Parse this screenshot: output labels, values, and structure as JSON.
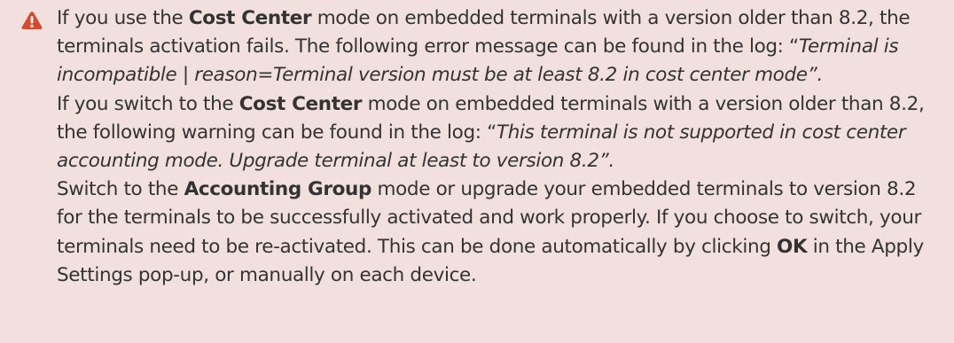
{
  "icon": {
    "name": "warning-icon",
    "color": "#d64a2e"
  },
  "paragraph1": {
    "t1": "If you use the ",
    "b1": "Cost Center",
    "t2": " mode on embedded terminals with a version older than 8.2, the terminals activation fails. The following error message can be found in the log: “",
    "i1": "Terminal is incompatible | reason=Terminal version must be at least 8.2 in cost center mode”.",
    "t3": ""
  },
  "paragraph2": {
    "t1": "If you switch to the ",
    "b1": "Cost Center",
    "t2": " mode on embedded terminals with a version older than 8.2, the following warning can be found in the log: “",
    "i1": "This terminal is not supported in cost center accounting mode. Upgrade terminal at least to version 8.2”.",
    "t3": ""
  },
  "paragraph3": {
    "t1": "Switch to the ",
    "b1": "Accounting Group",
    "t2": " mode or upgrade your embedded terminals to version 8.2 for the terminals to be successfully activated and work properly. If you choose to switch, your terminals need to be re-activated. This can be done automatically by clicking ",
    "b2": "OK",
    "t3": " in the Apply Settings pop-up, or manually on each device."
  },
  "colors": {
    "background": "#f1e0de",
    "text": "#333333",
    "warning": "#d64a2e"
  }
}
